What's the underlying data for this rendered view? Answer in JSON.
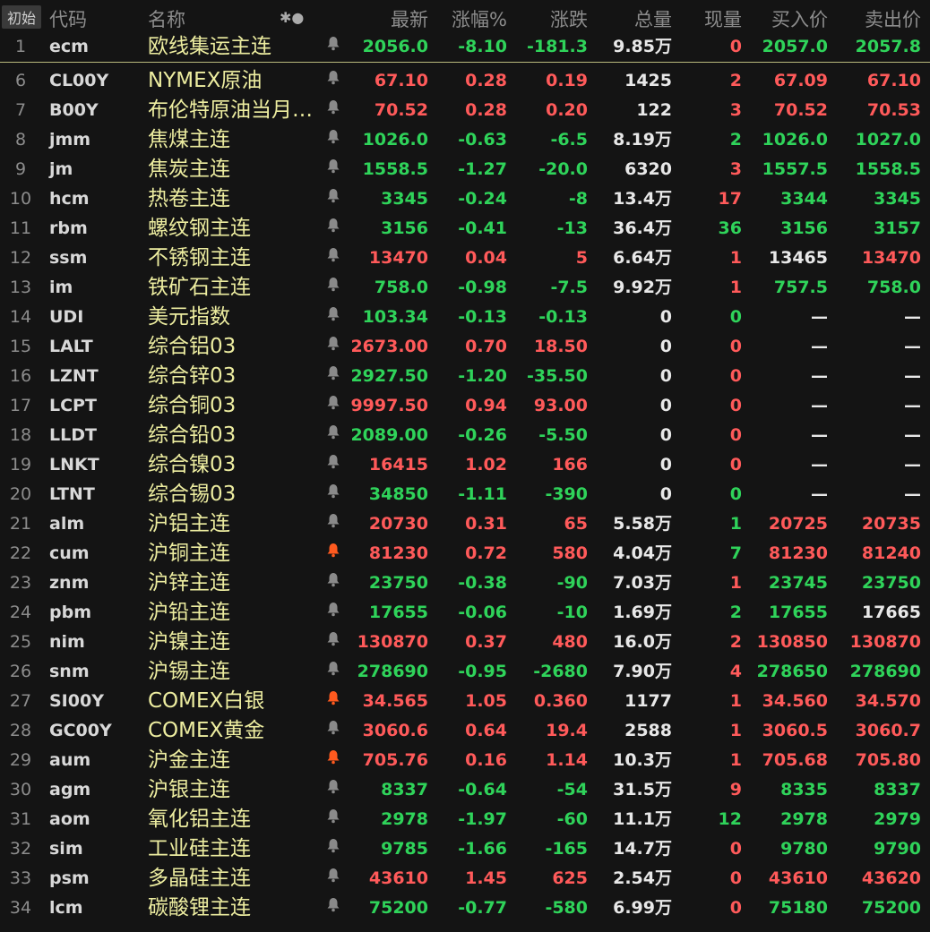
{
  "header": {
    "init_label": "初始",
    "code": "代码",
    "name": "名称",
    "icons": "✱●",
    "last": "最新",
    "pct": "涨幅%",
    "chg": "涨跌",
    "vol": "总量",
    "cur": "现量",
    "bid": "买入价",
    "ask": "卖出价"
  },
  "colors": {
    "up": "#ff5a5a",
    "down": "#2fd35a",
    "name": "#ededa0",
    "bell_active": "#ff5a1f"
  },
  "rows": [
    {
      "num": "1",
      "code": "ecm",
      "name": "欧线集运主连",
      "bell": "grey",
      "last": "2056.0",
      "pct": "-8.10",
      "chg": "-181.3",
      "vol": "9.85万",
      "cur": "0",
      "bid": "2057.0",
      "ask": "2057.8",
      "tone": "down",
      "cur_tone": "up",
      "bid_tone": "down",
      "ask_tone": "down"
    },
    {
      "num": "6",
      "code": "CL00Y",
      "name": "NYMEX原油",
      "bell": "grey",
      "last": "67.10",
      "pct": "0.28",
      "chg": "0.19",
      "vol": "1425",
      "cur": "2",
      "bid": "67.09",
      "ask": "67.10",
      "tone": "up",
      "cur_tone": "up",
      "bid_tone": "up",
      "ask_tone": "up"
    },
    {
      "num": "7",
      "code": "B00Y",
      "name": "布伦特原油当月…",
      "bell": "grey",
      "last": "70.52",
      "pct": "0.28",
      "chg": "0.20",
      "vol": "122",
      "cur": "3",
      "bid": "70.52",
      "ask": "70.53",
      "tone": "up",
      "cur_tone": "up",
      "bid_tone": "up",
      "ask_tone": "up"
    },
    {
      "num": "8",
      "code": "jmm",
      "name": "焦煤主连",
      "bell": "grey",
      "last": "1026.0",
      "pct": "-0.63",
      "chg": "-6.5",
      "vol": "8.19万",
      "cur": "2",
      "bid": "1026.0",
      "ask": "1027.0",
      "tone": "down",
      "cur_tone": "down",
      "bid_tone": "down",
      "ask_tone": "down"
    },
    {
      "num": "9",
      "code": "jm",
      "name": "焦炭主连",
      "bell": "grey",
      "last": "1558.5",
      "pct": "-1.27",
      "chg": "-20.0",
      "vol": "6320",
      "cur": "3",
      "bid": "1557.5",
      "ask": "1558.5",
      "tone": "down",
      "cur_tone": "up",
      "bid_tone": "down",
      "ask_tone": "down"
    },
    {
      "num": "10",
      "code": "hcm",
      "name": "热卷主连",
      "bell": "grey",
      "last": "3345",
      "pct": "-0.24",
      "chg": "-8",
      "vol": "13.4万",
      "cur": "17",
      "bid": "3344",
      "ask": "3345",
      "tone": "down",
      "cur_tone": "up",
      "bid_tone": "down",
      "ask_tone": "down"
    },
    {
      "num": "11",
      "code": "rbm",
      "name": "螺纹钢主连",
      "bell": "grey",
      "last": "3156",
      "pct": "-0.41",
      "chg": "-13",
      "vol": "36.4万",
      "cur": "36",
      "bid": "3156",
      "ask": "3157",
      "tone": "down",
      "cur_tone": "down",
      "bid_tone": "down",
      "ask_tone": "down"
    },
    {
      "num": "12",
      "code": "ssm",
      "name": "不锈钢主连",
      "bell": "grey",
      "last": "13470",
      "pct": "0.04",
      "chg": "5",
      "vol": "6.64万",
      "cur": "1",
      "bid": "13465",
      "ask": "13470",
      "tone": "up",
      "cur_tone": "up",
      "bid_tone": "white",
      "ask_tone": "up"
    },
    {
      "num": "13",
      "code": "im",
      "name": "铁矿石主连",
      "bell": "grey",
      "last": "758.0",
      "pct": "-0.98",
      "chg": "-7.5",
      "vol": "9.92万",
      "cur": "1",
      "bid": "757.5",
      "ask": "758.0",
      "tone": "down",
      "cur_tone": "up",
      "bid_tone": "down",
      "ask_tone": "down"
    },
    {
      "num": "14",
      "code": "UDI",
      "name": "美元指数",
      "bell": "grey",
      "last": "103.34",
      "pct": "-0.13",
      "chg": "-0.13",
      "vol": "0",
      "cur": "0",
      "bid": "—",
      "ask": "—",
      "tone": "down",
      "cur_tone": "down",
      "bid_tone": "white",
      "ask_tone": "white"
    },
    {
      "num": "15",
      "code": "LALT",
      "name": "综合铝03",
      "bell": "grey",
      "last": "2673.00",
      "pct": "0.70",
      "chg": "18.50",
      "vol": "0",
      "cur": "0",
      "bid": "—",
      "ask": "—",
      "tone": "up",
      "cur_tone": "up",
      "bid_tone": "white",
      "ask_tone": "white"
    },
    {
      "num": "16",
      "code": "LZNT",
      "name": "综合锌03",
      "bell": "grey",
      "last": "2927.50",
      "pct": "-1.20",
      "chg": "-35.50",
      "vol": "0",
      "cur": "0",
      "bid": "—",
      "ask": "—",
      "tone": "down",
      "cur_tone": "up",
      "bid_tone": "white",
      "ask_tone": "white"
    },
    {
      "num": "17",
      "code": "LCPT",
      "name": "综合铜03",
      "bell": "grey",
      "last": "9997.50",
      "pct": "0.94",
      "chg": "93.00",
      "vol": "0",
      "cur": "0",
      "bid": "—",
      "ask": "—",
      "tone": "up",
      "cur_tone": "up",
      "bid_tone": "white",
      "ask_tone": "white"
    },
    {
      "num": "18",
      "code": "LLDT",
      "name": "综合铅03",
      "bell": "grey",
      "last": "2089.00",
      "pct": "-0.26",
      "chg": "-5.50",
      "vol": "0",
      "cur": "0",
      "bid": "—",
      "ask": "—",
      "tone": "down",
      "cur_tone": "up",
      "bid_tone": "white",
      "ask_tone": "white"
    },
    {
      "num": "19",
      "code": "LNKT",
      "name": "综合镍03",
      "bell": "grey",
      "last": "16415",
      "pct": "1.02",
      "chg": "166",
      "vol": "0",
      "cur": "0",
      "bid": "—",
      "ask": "—",
      "tone": "up",
      "cur_tone": "up",
      "bid_tone": "white",
      "ask_tone": "white"
    },
    {
      "num": "20",
      "code": "LTNT",
      "name": "综合锡03",
      "bell": "grey",
      "last": "34850",
      "pct": "-1.11",
      "chg": "-390",
      "vol": "0",
      "cur": "0",
      "bid": "—",
      "ask": "—",
      "tone": "down",
      "cur_tone": "down",
      "bid_tone": "white",
      "ask_tone": "white"
    },
    {
      "num": "21",
      "code": "alm",
      "name": "沪铝主连",
      "bell": "grey",
      "last": "20730",
      "pct": "0.31",
      "chg": "65",
      "vol": "5.58万",
      "cur": "1",
      "bid": "20725",
      "ask": "20735",
      "tone": "up",
      "cur_tone": "down",
      "bid_tone": "up",
      "ask_tone": "up"
    },
    {
      "num": "22",
      "code": "cum",
      "name": "沪铜主连",
      "bell": "active",
      "last": "81230",
      "pct": "0.72",
      "chg": "580",
      "vol": "4.04万",
      "cur": "7",
      "bid": "81230",
      "ask": "81240",
      "tone": "up",
      "cur_tone": "down",
      "bid_tone": "up",
      "ask_tone": "up"
    },
    {
      "num": "23",
      "code": "znm",
      "name": "沪锌主连",
      "bell": "grey",
      "last": "23750",
      "pct": "-0.38",
      "chg": "-90",
      "vol": "7.03万",
      "cur": "1",
      "bid": "23745",
      "ask": "23750",
      "tone": "down",
      "cur_tone": "up",
      "bid_tone": "down",
      "ask_tone": "down"
    },
    {
      "num": "24",
      "code": "pbm",
      "name": "沪铅主连",
      "bell": "grey",
      "last": "17655",
      "pct": "-0.06",
      "chg": "-10",
      "vol": "1.69万",
      "cur": "2",
      "bid": "17655",
      "ask": "17665",
      "tone": "down",
      "cur_tone": "down",
      "bid_tone": "down",
      "ask_tone": "white"
    },
    {
      "num": "25",
      "code": "nim",
      "name": "沪镍主连",
      "bell": "grey",
      "last": "130870",
      "pct": "0.37",
      "chg": "480",
      "vol": "16.0万",
      "cur": "2",
      "bid": "130850",
      "ask": "130870",
      "tone": "up",
      "cur_tone": "up",
      "bid_tone": "up",
      "ask_tone": "up"
    },
    {
      "num": "26",
      "code": "snm",
      "name": "沪锡主连",
      "bell": "grey",
      "last": "278690",
      "pct": "-0.95",
      "chg": "-2680",
      "vol": "7.90万",
      "cur": "4",
      "bid": "278650",
      "ask": "278690",
      "tone": "down",
      "cur_tone": "up",
      "bid_tone": "down",
      "ask_tone": "down"
    },
    {
      "num": "27",
      "code": "SI00Y",
      "name": "COMEX白银",
      "bell": "active",
      "last": "34.565",
      "pct": "1.05",
      "chg": "0.360",
      "vol": "1177",
      "cur": "1",
      "bid": "34.560",
      "ask": "34.570",
      "tone": "up",
      "cur_tone": "up",
      "bid_tone": "up",
      "ask_tone": "up"
    },
    {
      "num": "28",
      "code": "GC00Y",
      "name": "COMEX黄金",
      "bell": "grey",
      "last": "3060.6",
      "pct": "0.64",
      "chg": "19.4",
      "vol": "2588",
      "cur": "1",
      "bid": "3060.5",
      "ask": "3060.7",
      "tone": "up",
      "cur_tone": "up",
      "bid_tone": "up",
      "ask_tone": "up"
    },
    {
      "num": "29",
      "code": "aum",
      "name": "沪金主连",
      "bell": "active",
      "last": "705.76",
      "pct": "0.16",
      "chg": "1.14",
      "vol": "10.3万",
      "cur": "1",
      "bid": "705.68",
      "ask": "705.80",
      "tone": "up",
      "cur_tone": "up",
      "bid_tone": "up",
      "ask_tone": "up"
    },
    {
      "num": "30",
      "code": "agm",
      "name": "沪银主连",
      "bell": "grey",
      "last": "8337",
      "pct": "-0.64",
      "chg": "-54",
      "vol": "31.5万",
      "cur": "9",
      "bid": "8335",
      "ask": "8337",
      "tone": "down",
      "cur_tone": "up",
      "bid_tone": "down",
      "ask_tone": "down"
    },
    {
      "num": "31",
      "code": "aom",
      "name": "氧化铝主连",
      "bell": "grey",
      "last": "2978",
      "pct": "-1.97",
      "chg": "-60",
      "vol": "11.1万",
      "cur": "12",
      "bid": "2978",
      "ask": "2979",
      "tone": "down",
      "cur_tone": "down",
      "bid_tone": "down",
      "ask_tone": "down"
    },
    {
      "num": "32",
      "code": "sim",
      "name": "工业硅主连",
      "bell": "grey",
      "last": "9785",
      "pct": "-1.66",
      "chg": "-165",
      "vol": "14.7万",
      "cur": "0",
      "bid": "9780",
      "ask": "9790",
      "tone": "down",
      "cur_tone": "up",
      "bid_tone": "down",
      "ask_tone": "down"
    },
    {
      "num": "33",
      "code": "psm",
      "name": "多晶硅主连",
      "bell": "grey",
      "last": "43610",
      "pct": "1.45",
      "chg": "625",
      "vol": "2.54万",
      "cur": "0",
      "bid": "43610",
      "ask": "43620",
      "tone": "up",
      "cur_tone": "up",
      "bid_tone": "up",
      "ask_tone": "up"
    },
    {
      "num": "34",
      "code": "lcm",
      "name": "碳酸锂主连",
      "bell": "grey",
      "last": "75200",
      "pct": "-0.77",
      "chg": "-580",
      "vol": "6.99万",
      "cur": "0",
      "bid": "75180",
      "ask": "75200",
      "tone": "down",
      "cur_tone": "up",
      "bid_tone": "down",
      "ask_tone": "down"
    }
  ]
}
